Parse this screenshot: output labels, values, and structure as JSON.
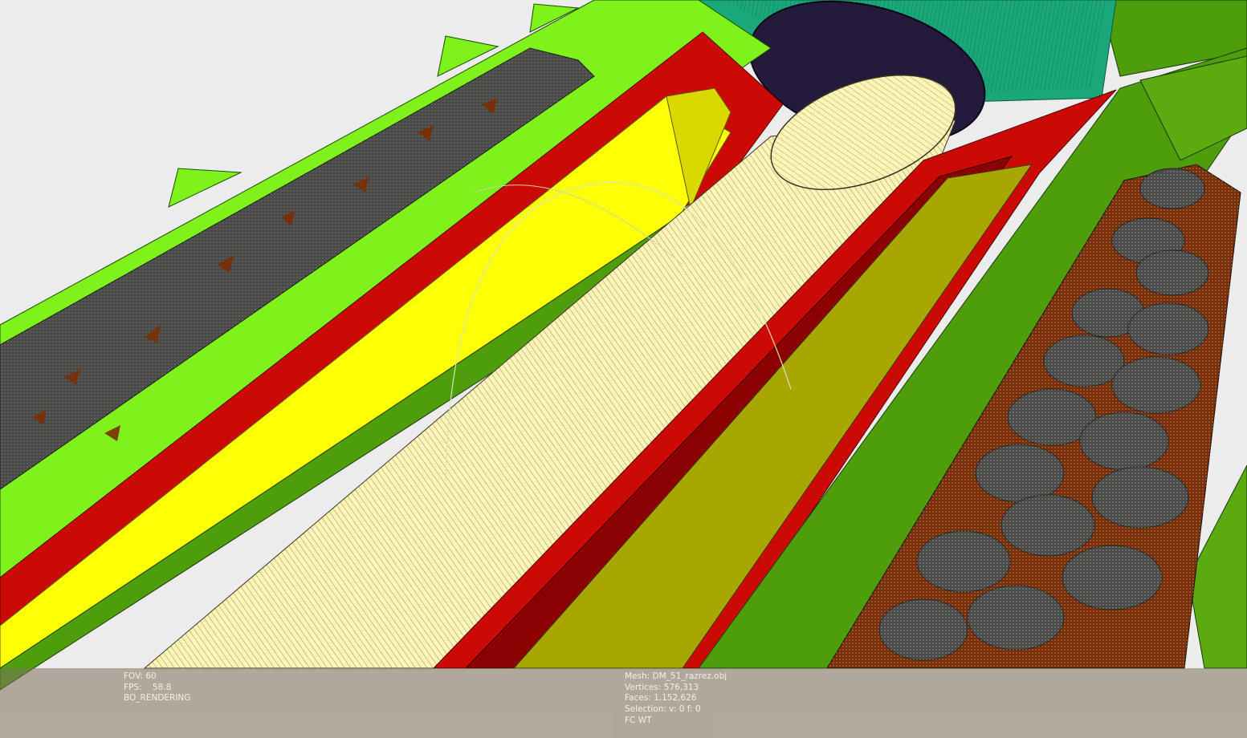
{
  "viewer": {
    "left_panel": {
      "fov": "FOV: 60",
      "fps": "FPS:    58.8",
      "mode": "BO_RENDERING"
    },
    "right_panel": {
      "mesh": "Mesh: DM_51_razrez.obj",
      "vertices": "Vertices: 576,313",
      "faces": "Faces: 1,152,626",
      "selection": "Selection: v: 0 f: 0",
      "flags": "FC WT"
    }
  },
  "colors": {
    "background": "#ececec",
    "lime_green": "#7ef21a",
    "dark_green": "#4e9d0b",
    "red": "#cc0a05",
    "yellow": "#ffff05",
    "olive_yellow": "#a8a600",
    "cream": "#fff5b6",
    "teal": "#1aa77a",
    "dark_navy": "#231a3c",
    "pebble_gray": "#4a4a48",
    "brown": "#7a2e05"
  }
}
